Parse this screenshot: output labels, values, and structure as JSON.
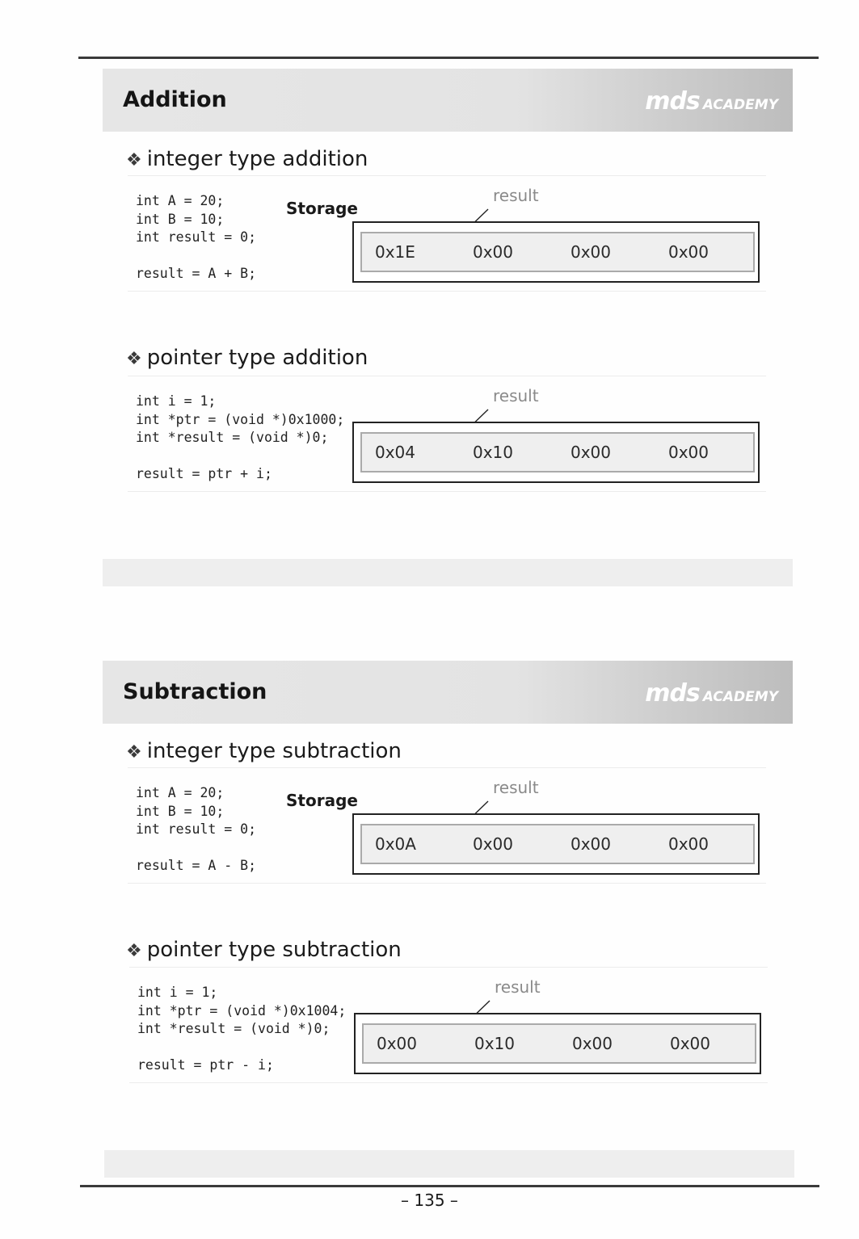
{
  "sections": [
    {
      "title": "Addition",
      "logo": {
        "brand": "mds",
        "academy": "ACADEMY"
      },
      "examples": [
        {
          "heading": "integer type addition",
          "code": "int A = 20;\nint B = 10;\nint result = 0;\n\nresult = A + B;",
          "storage_label": "Storage",
          "result_label": "result",
          "bytes": [
            "0x1E",
            "0x00",
            "0x00",
            "0x00"
          ]
        },
        {
          "heading": "pointer type addition",
          "code": "int i = 1;\nint *ptr = (void *)0x1000;\nint *result = (void *)0;\n\nresult = ptr + i;",
          "storage_label": "",
          "result_label": "result",
          "bytes": [
            "0x04",
            "0x10",
            "0x00",
            "0x00"
          ]
        }
      ]
    },
    {
      "title": "Subtraction",
      "logo": {
        "brand": "mds",
        "academy": "ACADEMY"
      },
      "examples": [
        {
          "heading": "integer type subtraction",
          "code": "int A = 20;\nint B = 10;\nint result = 0;\n\nresult = A - B;",
          "storage_label": "Storage",
          "result_label": "result",
          "bytes": [
            "0x0A",
            "0x00",
            "0x00",
            "0x00"
          ]
        },
        {
          "heading": "pointer type subtraction",
          "code": "int i = 1;\nint *ptr = (void *)0x1004;\nint *result = (void *)0;\n\nresult = ptr - i;",
          "storage_label": "",
          "result_label": "result",
          "bytes": [
            "0x00",
            "0x10",
            "0x00",
            "0x00"
          ]
        }
      ]
    }
  ],
  "page_number": "– 135 –",
  "bullet_glyph": "❖"
}
